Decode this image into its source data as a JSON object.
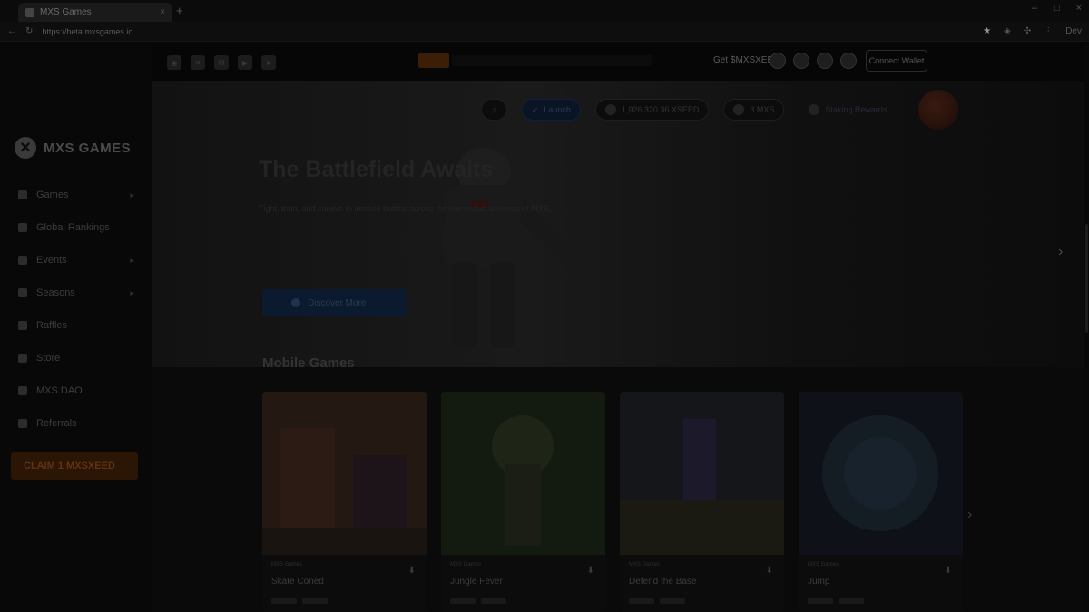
{
  "browser": {
    "tab_title": "MXS Games",
    "url": "https://beta.mxsgames.io",
    "profile_label": "Dev"
  },
  "sidebar": {
    "brand": "MXS GAMES",
    "items": [
      {
        "label": "Games",
        "icon": "gamepad-icon",
        "expandable": true
      },
      {
        "label": "Global Rankings",
        "icon": "trophy-icon",
        "expandable": false
      },
      {
        "label": "Events",
        "icon": "calendar-icon",
        "expandable": true
      },
      {
        "label": "Seasons",
        "icon": "leaf-icon",
        "expandable": true
      },
      {
        "label": "Raffles",
        "icon": "ticket-icon",
        "expandable": false
      },
      {
        "label": "Store",
        "icon": "cart-icon",
        "expandable": false
      },
      {
        "label": "MXS DAO",
        "icon": "people-icon",
        "expandable": false
      },
      {
        "label": "Referrals",
        "icon": "gift-icon",
        "expandable": false
      }
    ],
    "claim_label": "CLAIM 1 MXSXEED"
  },
  "topbar": {
    "get_token_label": "Get $MXSXEED",
    "connect_label": "Connect Wallet"
  },
  "hero": {
    "title": "The Battlefield Awaits",
    "subtitle": "Fight, train, and survive in intense battles across the immersive universe of MXS.",
    "cta_label": "Discover More"
  },
  "pills": {
    "launch_label": "Launch",
    "balance_label": "1,926,320.36 XSEED",
    "mxs_label": "3 MXS",
    "staking_label": "Staking Rewards"
  },
  "section": {
    "title": "Mobile Games",
    "cards": [
      {
        "category": "MXS Games",
        "title": "Skate Coned"
      },
      {
        "category": "MXS Games",
        "title": "Jungle Fever"
      },
      {
        "category": "MXS Games",
        "title": "Defend the Base"
      },
      {
        "category": "MXS Games",
        "title": "Jump"
      }
    ]
  },
  "colors": {
    "claim_accent": "#5e3414",
    "launch_accent": "#2a3b55",
    "overlay": "#050505"
  }
}
